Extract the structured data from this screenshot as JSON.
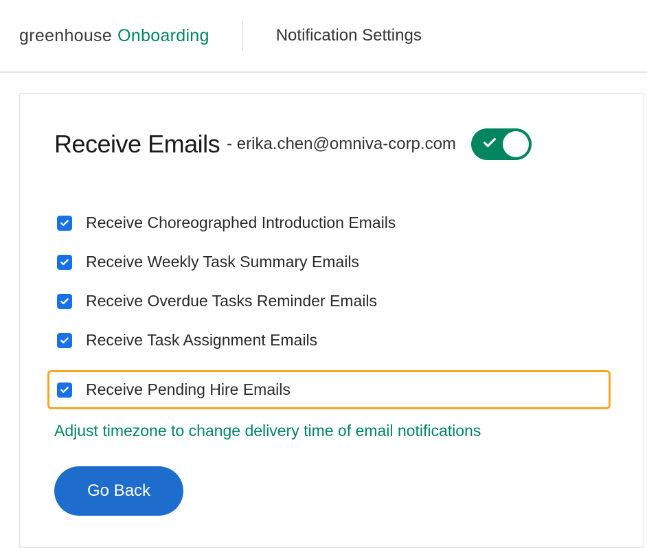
{
  "header": {
    "logo_greenhouse": "greenhouse",
    "logo_onboarding": "Onboarding",
    "title": "Notification Settings"
  },
  "card": {
    "title": "Receive Emails",
    "email_prefix": "- ",
    "email": "erika.chen@omniva-corp.com",
    "toggle_on": true
  },
  "checkboxes": [
    {
      "label": "Receive Choreographed Introduction Emails",
      "checked": true,
      "highlighted": false
    },
    {
      "label": "Receive Weekly Task Summary Emails",
      "checked": true,
      "highlighted": false
    },
    {
      "label": "Receive Overdue Tasks Reminder Emails",
      "checked": true,
      "highlighted": false
    },
    {
      "label": "Receive Task Assignment Emails",
      "checked": true,
      "highlighted": false
    },
    {
      "label": "Receive Pending Hire Emails",
      "checked": true,
      "highlighted": true
    }
  ],
  "timezone_link": "Adjust timezone to change delivery time of email notifications",
  "go_back_label": "Go Back"
}
